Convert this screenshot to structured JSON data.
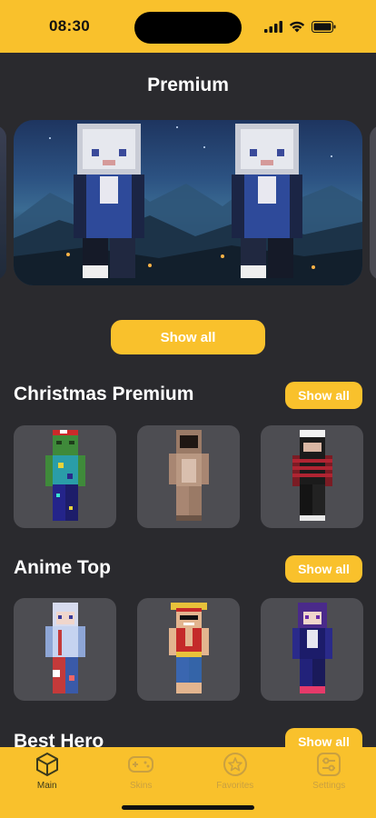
{
  "status": {
    "time": "08:30"
  },
  "premium": {
    "title": "Premium",
    "show_all": "Show all"
  },
  "sections": [
    {
      "title": "Christmas Premium",
      "button": "Show all"
    },
    {
      "title": "Anime Top",
      "button": "Show all"
    },
    {
      "title": "Best Hero",
      "button": "Show all"
    }
  ],
  "tabs": [
    {
      "label": "Main",
      "icon": "cube-icon",
      "active": true
    },
    {
      "label": "Skins",
      "icon": "gamepad-icon",
      "active": false
    },
    {
      "label": "Favorites",
      "icon": "star-icon",
      "active": false
    },
    {
      "label": "Settings",
      "icon": "sliders-icon",
      "active": false
    }
  ],
  "colors": {
    "accent": "#f9c12c",
    "background": "#2a2a2e",
    "card": "#4d4d52"
  }
}
